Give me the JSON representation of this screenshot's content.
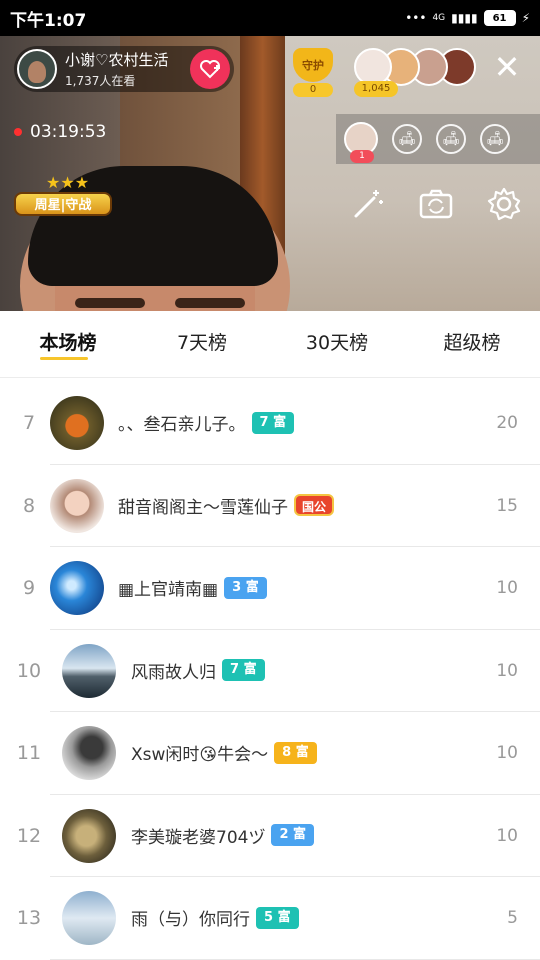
{
  "status_bar": {
    "time": "下午1:07",
    "signal_text": "4G",
    "battery": "61"
  },
  "live": {
    "host_name": "小谢♡农村生活",
    "viewers_text": "1,737人在看",
    "guard_label": "守护",
    "guard_count": "0",
    "viewer_total": "1,045",
    "timer": "03:19:53",
    "seat_badge": "1",
    "weekly_badge": "周星|守战"
  },
  "tabs": [
    "本场榜",
    "7天榜",
    "30天榜",
    "超级榜"
  ],
  "active_tab": 0,
  "ranking": [
    {
      "rank": "7",
      "name": "。、叁石亲儿子。",
      "badge": "7 富",
      "badge_color": "teal",
      "score": "20"
    },
    {
      "rank": "8",
      "name": "甜音阁阁主～雪莲仙子",
      "badge": "国公",
      "badge_color": "gov",
      "score": "15"
    },
    {
      "rank": "9",
      "name": "▦上官靖南▦",
      "badge": "3 富",
      "badge_color": "blue",
      "score": "10"
    },
    {
      "rank": "10",
      "name": "风雨故人归",
      "badge": "7 富",
      "badge_color": "teal",
      "score": "10"
    },
    {
      "rank": "11",
      "name": "Xsw闲时😘牛会～",
      "badge": "8 富",
      "badge_color": "orange",
      "score": "10"
    },
    {
      "rank": "12",
      "name": "李美璇老婆704ヅ",
      "badge": "2 富",
      "badge_color": "blue",
      "score": "10"
    },
    {
      "rank": "13",
      "name": "雨（与）你同行",
      "badge": "5 富",
      "badge_color": "teal",
      "score": "5"
    }
  ]
}
